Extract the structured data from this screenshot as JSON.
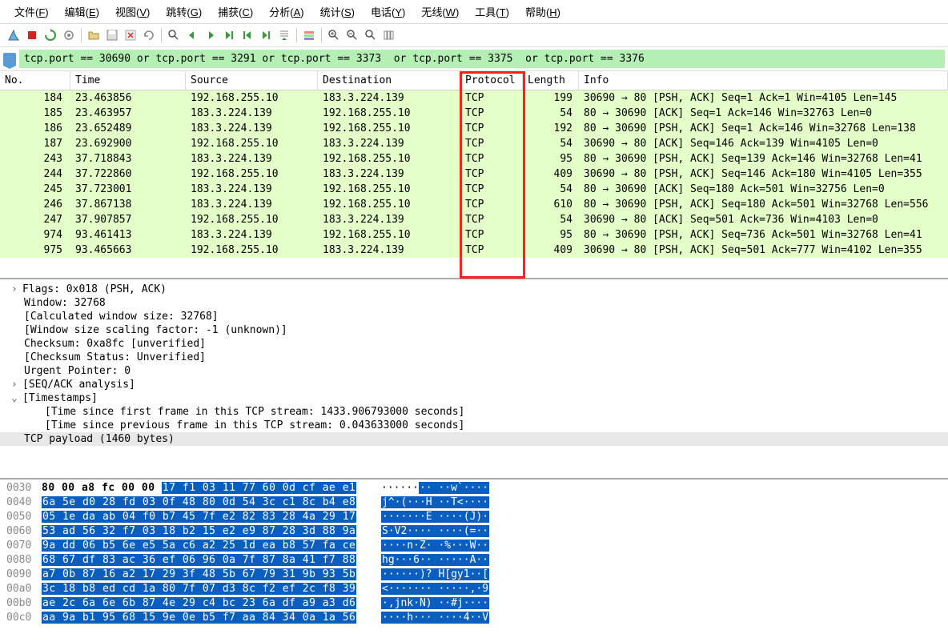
{
  "menu": [
    "文件(F)",
    "编辑(E)",
    "视图(V)",
    "跳转(G)",
    "捕获(C)",
    "分析(A)",
    "统计(S)",
    "电话(Y)",
    "无线(W)",
    "工具(T)",
    "帮助(H)"
  ],
  "filter": "tcp.port == 30690 or tcp.port == 3291 or tcp.port == 3373  or tcp.port == 3375  or tcp.port == 3376",
  "columns": [
    "No.",
    "Time",
    "Source",
    "Destination",
    "Protocol",
    "Length",
    "Info"
  ],
  "packets": [
    {
      "no": "184",
      "time": "23.463856",
      "src": "192.168.255.10",
      "dst": "183.3.224.139",
      "proto": "TCP",
      "len": "199",
      "info": "30690 → 80 [PSH, ACK] Seq=1 Ack=1 Win=4105 Len=145"
    },
    {
      "no": "185",
      "time": "23.463957",
      "src": "183.3.224.139",
      "dst": "192.168.255.10",
      "proto": "TCP",
      "len": "54",
      "info": "80 → 30690 [ACK] Seq=1 Ack=146 Win=32763 Len=0"
    },
    {
      "no": "186",
      "time": "23.652489",
      "src": "183.3.224.139",
      "dst": "192.168.255.10",
      "proto": "TCP",
      "len": "192",
      "info": "80 → 30690 [PSH, ACK] Seq=1 Ack=146 Win=32768 Len=138"
    },
    {
      "no": "187",
      "time": "23.692900",
      "src": "192.168.255.10",
      "dst": "183.3.224.139",
      "proto": "TCP",
      "len": "54",
      "info": "30690 → 80 [ACK] Seq=146 Ack=139 Win=4105 Len=0"
    },
    {
      "no": "243",
      "time": "37.718843",
      "src": "183.3.224.139",
      "dst": "192.168.255.10",
      "proto": "TCP",
      "len": "95",
      "info": "80 → 30690 [PSH, ACK] Seq=139 Ack=146 Win=32768 Len=41"
    },
    {
      "no": "244",
      "time": "37.722860",
      "src": "192.168.255.10",
      "dst": "183.3.224.139",
      "proto": "TCP",
      "len": "409",
      "info": "30690 → 80 [PSH, ACK] Seq=146 Ack=180 Win=4105 Len=355"
    },
    {
      "no": "245",
      "time": "37.723001",
      "src": "183.3.224.139",
      "dst": "192.168.255.10",
      "proto": "TCP",
      "len": "54",
      "info": "80 → 30690 [ACK] Seq=180 Ack=501 Win=32756 Len=0"
    },
    {
      "no": "246",
      "time": "37.867138",
      "src": "183.3.224.139",
      "dst": "192.168.255.10",
      "proto": "TCP",
      "len": "610",
      "info": "80 → 30690 [PSH, ACK] Seq=180 Ack=501 Win=32768 Len=556"
    },
    {
      "no": "247",
      "time": "37.907857",
      "src": "192.168.255.10",
      "dst": "183.3.224.139",
      "proto": "TCP",
      "len": "54",
      "info": "30690 → 80 [ACK] Seq=501 Ack=736 Win=4103 Len=0"
    },
    {
      "no": "974",
      "time": "93.461413",
      "src": "183.3.224.139",
      "dst": "192.168.255.10",
      "proto": "TCP",
      "len": "95",
      "info": "80 → 30690 [PSH, ACK] Seq=736 Ack=501 Win=32768 Len=41"
    },
    {
      "no": "975",
      "time": "93.465663",
      "src": "192.168.255.10",
      "dst": "183.3.224.139",
      "proto": "TCP",
      "len": "409",
      "info": "30690 → 80 [PSH, ACK] Seq=501 Ack=777 Win=4102 Len=355"
    }
  ],
  "details": [
    {
      "t": "Flags: 0x018 (PSH, ACK)",
      "lvl": 0,
      "exp": "collapsed"
    },
    {
      "t": "Window: 32768",
      "lvl": 0
    },
    {
      "t": "[Calculated window size: 32768]",
      "lvl": 0
    },
    {
      "t": "[Window size scaling factor: -1 (unknown)]",
      "lvl": 0
    },
    {
      "t": "Checksum: 0xa8fc [unverified]",
      "lvl": 0
    },
    {
      "t": "[Checksum Status: Unverified]",
      "lvl": 0
    },
    {
      "t": "Urgent Pointer: 0",
      "lvl": 0
    },
    {
      "t": "[SEQ/ACK analysis]",
      "lvl": 0,
      "exp": "collapsed"
    },
    {
      "t": "[Timestamps]",
      "lvl": 0,
      "exp": "expanded"
    },
    {
      "t": "[Time since first frame in this TCP stream: 1433.906793000 seconds]",
      "lvl": 1
    },
    {
      "t": "[Time since previous frame in this TCP stream: 0.043633000 seconds]",
      "lvl": 1
    },
    {
      "t": "TCP payload (1460 bytes)",
      "lvl": 0,
      "sel": true
    }
  ],
  "hex": [
    {
      "off": "0030",
      "plain": "80 00 a8 fc 00 00 ",
      "hl": "17 f1   03 11 77 60 0d cf ae e1",
      "aplain": "······",
      "ahl": "··   ··w`····"
    },
    {
      "off": "0040",
      "hl": "6a 5e d0 28 fd 03 0f 48   80 0d 54 3c c1 8c b4 e8",
      "ahl": "j^·(···H  ··T<····"
    },
    {
      "off": "0050",
      "hl": "05 1e da ab 04 f0 b7 45   7f e2 82 83 28 4a 29 17",
      "ahl": "·······E  ····(J)·"
    },
    {
      "off": "0060",
      "hl": "53 ad 56 32 f7 03 18 b2   15 e2 e9 87 28 3d 88 9a",
      "ahl": "S·V2····  ····(=··"
    },
    {
      "off": "0070",
      "hl": "9a dd 06 b5 6e e5 5a c6   a2 25 1d ea b8 57 fa ce",
      "ahl": "····n·Z·  ·%···W··"
    },
    {
      "off": "0080",
      "hl": "68 67 df 83 ac 36 ef 06   96 0a 7f 87 8a 41 f7 88",
      "ahl": "hg···6··  ·····A··"
    },
    {
      "off": "0090",
      "hl": "a7 0b 87 16 a2 17 29 3f   48 5b 67 79 31 9b 93 5b",
      "ahl": "······)?  H[gy1··["
    },
    {
      "off": "00a0",
      "hl": "3c 18 b8 ed cd 1a 80 7f   07 d3 8c f2 ef 2c f8 39",
      "ahl": "<·······  ·····,·9"
    },
    {
      "off": "00b0",
      "hl": "ae 2c 6a 6e 6b 87 4e 29   c4 bc 23 6a df a9 a3 d6",
      "ahl": "·,jnk·N)  ··#j····"
    },
    {
      "off": "00c0",
      "hl": "aa 9a b1 95 68 15 9e 0e   b5 f7 aa 84 34 0a 1a 56",
      "ahl": "····h···  ····4··V"
    }
  ]
}
